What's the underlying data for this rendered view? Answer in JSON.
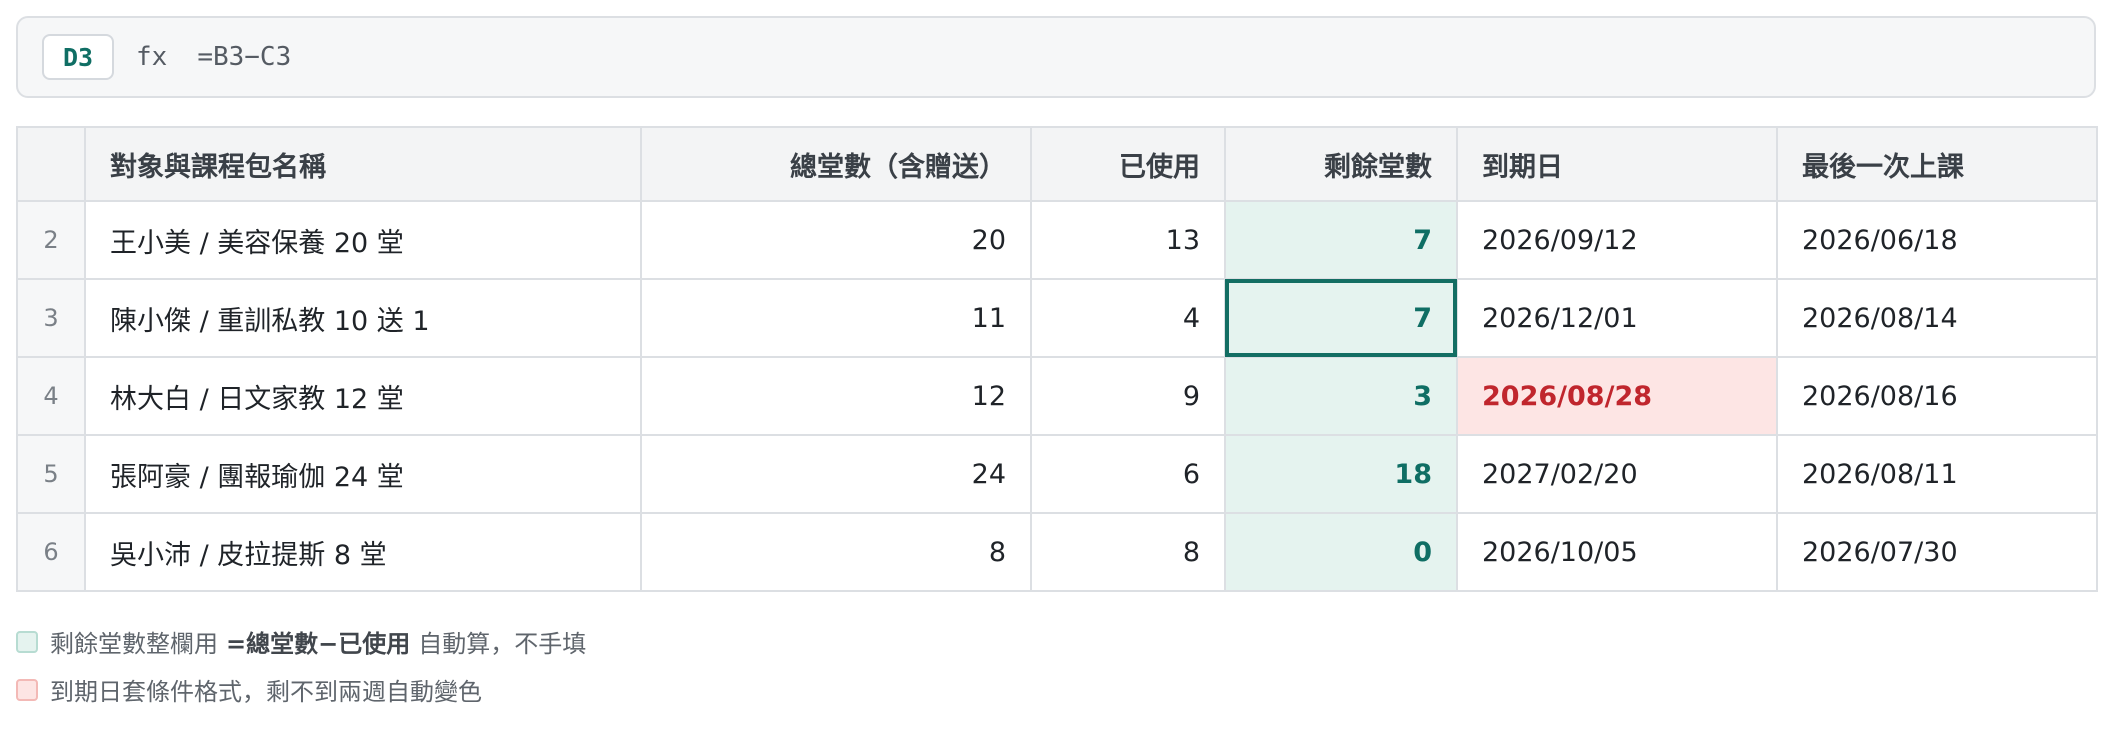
{
  "formula_bar": {
    "cell_ref": "D3",
    "fx_label": "fx",
    "formula": "=B3−C3"
  },
  "sheet": {
    "columns": [
      "",
      "對象與課程包名稱",
      "總堂數（含贈送）",
      "已使用",
      "剩餘堂數",
      "到期日",
      "最後一次上課"
    ],
    "rows": [
      {
        "num": "2",
        "name": "王小美 / 美容保養 20 堂",
        "total": "20",
        "used": "13",
        "remaining": "7",
        "expiry": "2026/09/12",
        "last": "2026/06/18"
      },
      {
        "num": "3",
        "name": "陳小傑 / 重訓私教 10 送 1",
        "total": "11",
        "used": "4",
        "remaining": "7",
        "expiry": "2026/12/01",
        "last": "2026/08/14"
      },
      {
        "num": "4",
        "name": "林大白 / 日文家教 12 堂",
        "total": "12",
        "used": "9",
        "remaining": "3",
        "expiry": "2026/08/28",
        "last": "2026/08/16"
      },
      {
        "num": "5",
        "name": "張阿豪 / 團報瑜伽 24 堂",
        "total": "24",
        "used": "6",
        "remaining": "18",
        "expiry": "2027/02/20",
        "last": "2026/08/11"
      },
      {
        "num": "6",
        "name": "吳小沛 / 皮拉提斯 8 堂",
        "total": "8",
        "used": "8",
        "remaining": "0",
        "expiry": "2026/10/05",
        "last": "2026/07/30"
      }
    ]
  },
  "legend": {
    "remaining_prefix": "剩餘堂數整欄用",
    "remaining_formula": "=總堂數−已使用",
    "remaining_suffix": "自動算，不手填",
    "expiry_note": "到期日套條件格式，剩不到兩週自動變色"
  },
  "colors": {
    "accent": "#0f6e64",
    "remaining_fill": "#e5f3ef",
    "warning_fill": "#fde5e4",
    "warning_text": "#c0262d"
  }
}
